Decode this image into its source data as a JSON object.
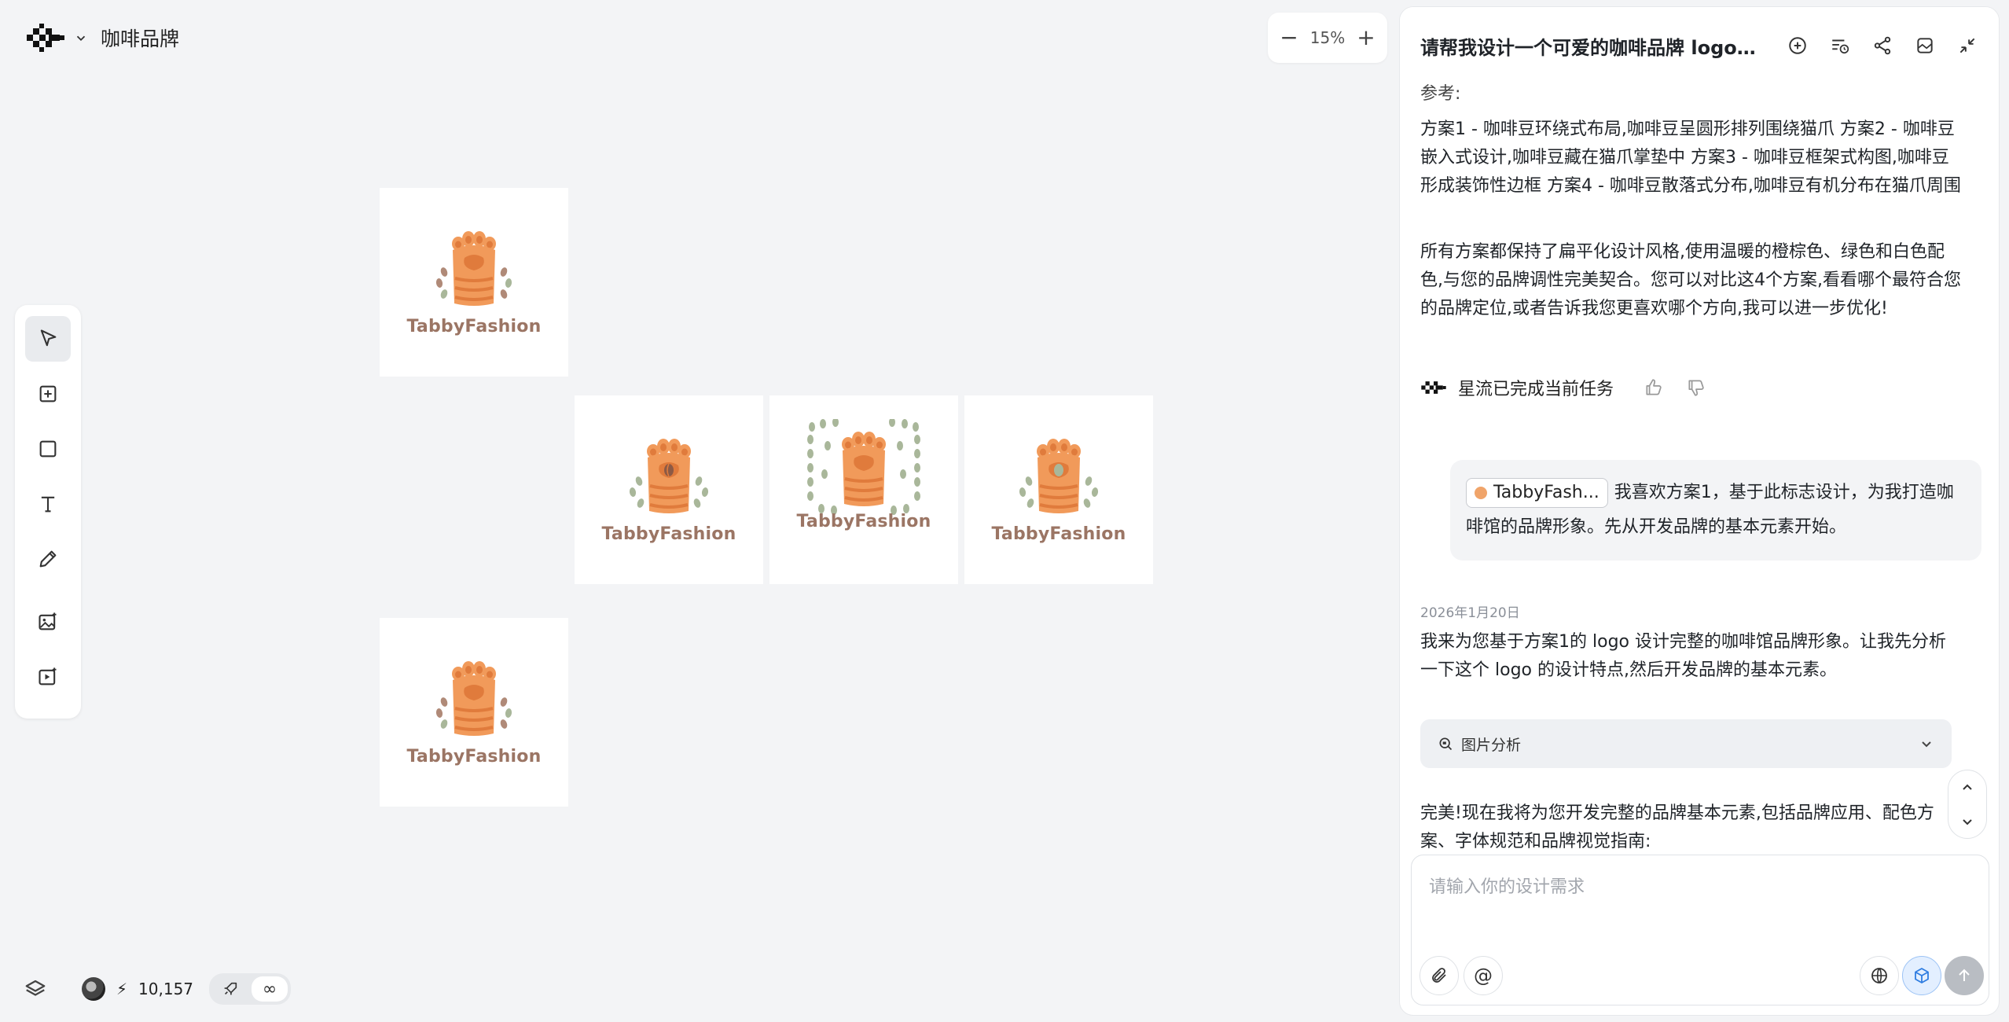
{
  "project": {
    "name": "咖啡品牌"
  },
  "zoom": {
    "minus": "−",
    "value": "15%",
    "plus": "+"
  },
  "cards": [
    {
      "label": "TabbyFashion"
    },
    {
      "label": "TabbyFashion"
    },
    {
      "label": "TabbyFashion"
    },
    {
      "label": "TabbyFashion"
    },
    {
      "label": "TabbyFashion"
    }
  ],
  "bottom": {
    "credits": "10,157",
    "bolt": "⚡",
    "infinity": "∞"
  },
  "chat": {
    "title": "请帮我设计一个可爱的咖啡品牌 logo。这...",
    "ref_label": "参考:",
    "para1": "方案1 - 咖啡豆环绕式布局,咖啡豆呈圆形排列围绕猫爪 方案2 - 咖啡豆嵌入式设计,咖啡豆藏在猫爪掌垫中 方案3 - 咖啡豆框架式构图,咖啡豆形成装饰性边框 方案4 - 咖啡豆散落式分布,咖啡豆有机分布在猫爪周围",
    "para2": "所有方案都保持了扁平化设计风格,使用温暖的橙棕色、绿色和白色配色,与您的品牌调性完美契合。您可以对比这4个方案,看看哪个最符合您的品牌定位,或者告诉我您更喜欢哪个方向,我可以进一步优化!",
    "done_text": "星流已完成当前任务",
    "user_chip": "TabbyFash...",
    "user_message": "我喜欢方案1，基于此标志设计，为我打造咖啡馆的品牌形象。先从开发品牌的基本元素开始。",
    "date": "2026年1月20日",
    "para3": "我来为您基于方案1的 logo 设计完整的咖啡馆品牌形象。让我先分析一下这个 logo 的设计特点,然后开发品牌的基本元素。",
    "analysis_label": "图片分析",
    "para4": "完美!现在我将为您开发完整的品牌基本元素,包括品牌应用、配色方案、字体规范和品牌视觉指南:",
    "input_placeholder": "请输入你的设计需求",
    "mention": "@"
  },
  "colors": {
    "paw": "#f19a5a",
    "pad": "#e07b3c",
    "bean_brown": "#b08a78",
    "bean_green": "#a9b79a",
    "text": "#9b7564"
  }
}
